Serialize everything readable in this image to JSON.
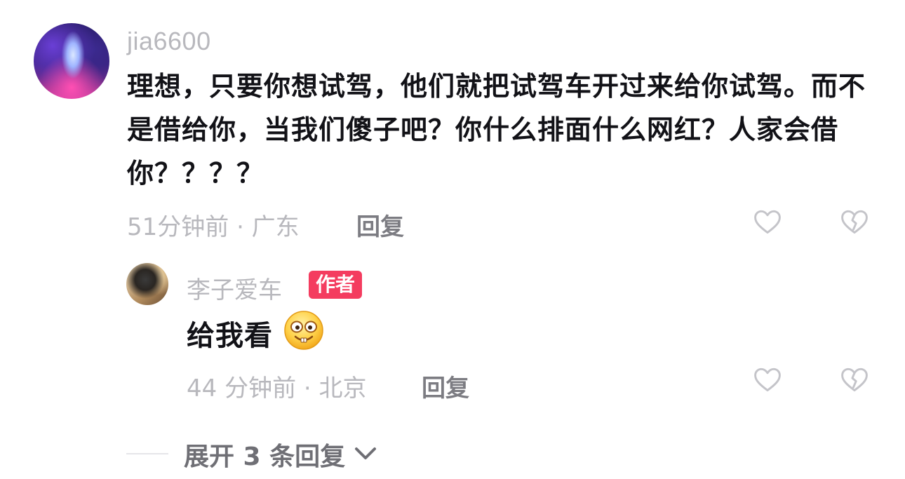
{
  "comment": {
    "username": "jia6600",
    "text": "理想，只要你想试驾，他们就把试驾车开过来给你试驾。而不是借给你，当我们傻子吧？你什么排面什么网红？人家会借你？？？？",
    "meta": "51分钟前 · 广东",
    "reply_label": "回复",
    "like_icon": "heart-outline-icon",
    "dislike_icon": "broken-heart-icon"
  },
  "reply": {
    "username": "李子爱车",
    "badge": "作者",
    "text": "给我看",
    "emoji": "nerd-face-emoji",
    "meta": "44 分钟前 · 北京",
    "reply_label": "回复",
    "like_icon": "heart-outline-icon",
    "dislike_icon": "broken-heart-icon"
  },
  "expand": {
    "label": "展开 3 条回复",
    "icon": "chevron-down-icon"
  },
  "colors": {
    "text": "#121217",
    "muted": "#b8b8bd",
    "action": "#7c7c82",
    "badge": "#f43c5f"
  }
}
